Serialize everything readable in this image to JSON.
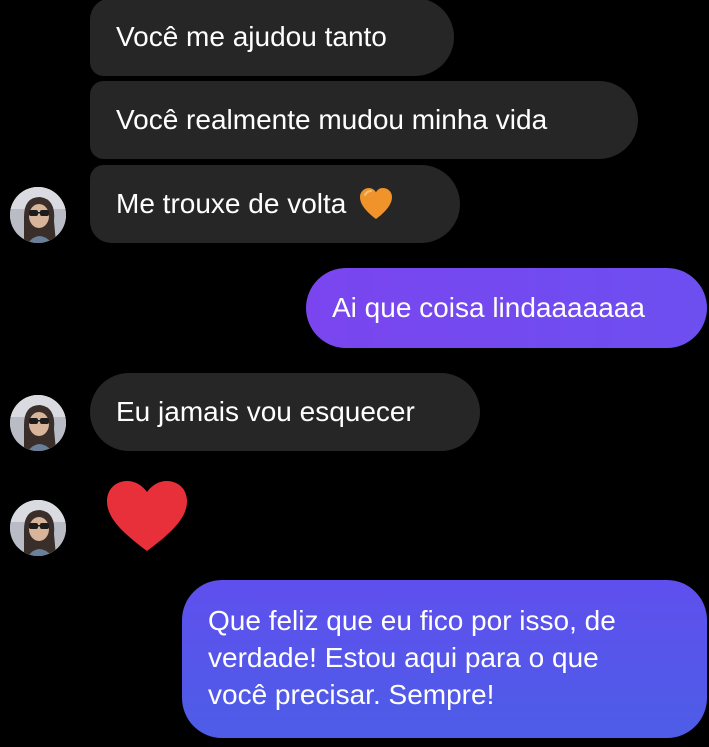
{
  "messages": [
    {
      "from": "them",
      "text": "Você me ajudou tanto"
    },
    {
      "from": "them",
      "text": "Você realmente mudou minha vida"
    },
    {
      "from": "them",
      "text": "Me trouxe de volta",
      "emoji": "orange-heart-icon"
    },
    {
      "from": "me",
      "text": "Ai que coisa lindaaaaaaa"
    },
    {
      "from": "them",
      "text": "Eu jamais vou esquecer"
    },
    {
      "from": "them",
      "emoji": "red-heart-icon"
    },
    {
      "from": "me",
      "lines": [
        "Que feliz que eu fico por isso, de",
        "verdade! Estou aqui para o que",
        "você precisar. Sempre!"
      ]
    }
  ],
  "colors": {
    "background": "#000000",
    "incoming_bubble": "#262626",
    "outgoing_gradient_top": "#7b47f0",
    "outgoing_gradient_bottom": "#4f5be6",
    "orange_heart": "#f0932b",
    "red_heart": "#e8303a"
  }
}
